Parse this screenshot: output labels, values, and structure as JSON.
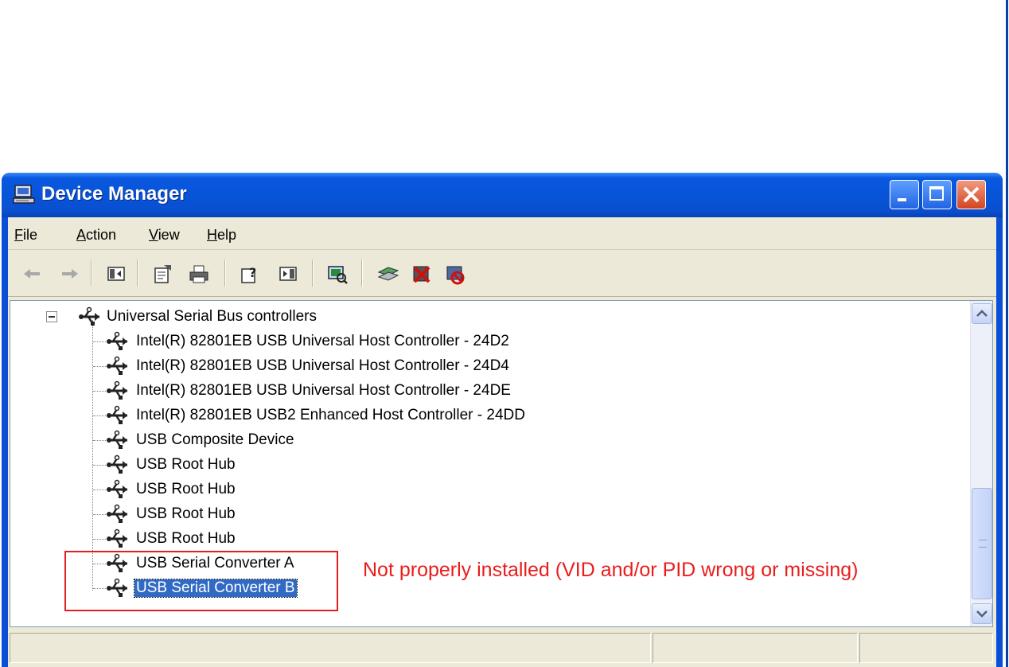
{
  "window": {
    "title": "Device Manager",
    "icon": "computer-icon",
    "controls": [
      "minimize-icon",
      "maximize-icon",
      "close-icon"
    ]
  },
  "menu": [
    {
      "label": "File",
      "mnemonic": "F"
    },
    {
      "label": "Action",
      "mnemonic": "A"
    },
    {
      "label": "View",
      "mnemonic": "V"
    },
    {
      "label": "Help",
      "mnemonic": "H"
    }
  ],
  "toolbar": {
    "buttons": [
      "back-arrow-icon",
      "forward-arrow-icon",
      "show-hide-console-tree-icon",
      "properties-icon",
      "print-icon",
      "help-icon",
      "show-hide-action-pane-icon",
      "scan-hardware-icon",
      "update-driver-icon",
      "uninstall-icon",
      "disable-icon"
    ]
  },
  "tree": {
    "root": {
      "label": "Universal Serial Bus controllers",
      "expanded": true
    },
    "items": [
      {
        "label": "Intel(R) 82801EB USB Universal Host Controller - 24D2"
      },
      {
        "label": "Intel(R) 82801EB USB Universal Host Controller - 24D4"
      },
      {
        "label": "Intel(R) 82801EB USB Universal Host Controller - 24DE"
      },
      {
        "label": "Intel(R) 82801EB USB2 Enhanced Host Controller - 24DD"
      },
      {
        "label": "USB Composite Device"
      },
      {
        "label": "USB Root Hub"
      },
      {
        "label": "USB Root Hub"
      },
      {
        "label": "USB Root Hub"
      },
      {
        "label": "USB Root Hub"
      },
      {
        "label": "USB Serial Converter A"
      },
      {
        "label": "USB Serial Converter B",
        "selected": true
      }
    ]
  },
  "annotation": {
    "text": "Not properly installed (VID and/or PID wrong or missing)",
    "color": "#ea1c1c"
  },
  "colors": {
    "titlebar": "#0754d8",
    "frame": "#ece9d8",
    "selection": "#316ac5"
  }
}
